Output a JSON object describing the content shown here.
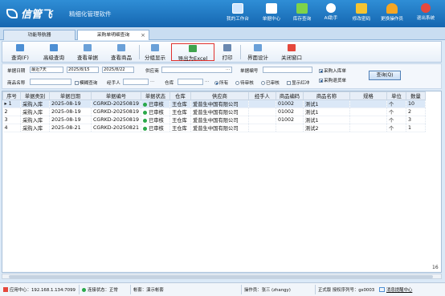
{
  "app": {
    "logo_text": "信管飞",
    "slogan": "精细化管理软件"
  },
  "top_buttons": [
    {
      "label": "我的工作台",
      "icon": "monitor-icon",
      "color": "#cfe6ff"
    },
    {
      "label": "单据中心",
      "icon": "list-icon",
      "color": "#ffffff"
    },
    {
      "label": "库存查询",
      "icon": "table-icon",
      "color": "#7fd34a"
    },
    {
      "label": "AI助手",
      "icon": "info-icon",
      "color": "#ffffff"
    },
    {
      "label": "修改密码",
      "icon": "lock-icon",
      "color": "#f5c431"
    },
    {
      "label": "更换操作员",
      "icon": "user-icon",
      "color": "#f5a623"
    },
    {
      "label": "退出系统",
      "icon": "exit-icon",
      "color": "#e5483c"
    }
  ],
  "tabs": [
    {
      "label": "功能导航器"
    },
    {
      "label": "采购单明细查询"
    }
  ],
  "tab_close": "×",
  "toolbar": [
    {
      "label": "查询(F)",
      "icon": "search-icon",
      "color": "#4d8fd4"
    },
    {
      "label": "高级查询",
      "icon": "advanced-search-icon",
      "color": "#4d8fd4"
    },
    {
      "label": "查看单据",
      "icon": "document-icon",
      "color": "#6aa0d8"
    },
    {
      "label": "查看商品",
      "icon": "product-icon",
      "color": "#6aa0d8"
    },
    {
      "label": "分组显示",
      "icon": "group-icon",
      "color": "#6aa0d8"
    },
    {
      "label": "导出为Excel",
      "icon": "excel-icon",
      "color": "#3fa34d"
    },
    {
      "label": "打印",
      "icon": "print-icon",
      "color": "#6a88b0"
    },
    {
      "label": "界面设计",
      "icon": "design-icon",
      "color": "#6aa0d8"
    },
    {
      "label": "关闭窗口",
      "icon": "close-window-icon",
      "color": "#e5483c"
    }
  ],
  "filters": {
    "date_label": "单据日期",
    "date_range": "最近7天",
    "date_from": "2025/8/15",
    "date_to": "2025/8/22",
    "supplier_label": "供应商",
    "supplier_value": "",
    "doc_no_label": "单据编号",
    "doc_no_value": "",
    "product_label": "商品名称",
    "fuzzy_label": "模糊查询",
    "handler_label": "经手人",
    "warehouse_label": "仓库",
    "radio_all": "所有",
    "radio_unaudited": "待审核",
    "radio_audited": "已审核",
    "show_red": "显示红冲",
    "chk_purchase_in": "采购入库单",
    "chk_purchase_return": "采购退货单",
    "query_button": "查询(Q)",
    "ellipsis": "..."
  },
  "table": {
    "columns": [
      "序号",
      "单据类别",
      "单据日期",
      "单据编号",
      "单据状态",
      "仓库",
      "供应商",
      "经手人",
      "商品编码",
      "商品名称",
      "规格",
      "单位",
      "数量"
    ],
    "rows": [
      {
        "idx": "1",
        "type": "采购入库",
        "date": "2025-08-19",
        "no": "CGRKD-20250819",
        "status": "已审核",
        "wh": "王仓库",
        "supplier": "爱普生中国有限公司",
        "handler": "",
        "code": "01002",
        "name": "测试1",
        "spec": "",
        "unit": "个",
        "qty": "10"
      },
      {
        "idx": "2",
        "type": "采购入库",
        "date": "2025-08-19",
        "no": "CGRKD-20250819",
        "status": "已审核",
        "wh": "王仓库",
        "supplier": "爱普生中国有限公司",
        "handler": "",
        "code": "01002",
        "name": "测试1",
        "spec": "",
        "unit": "个",
        "qty": "2"
      },
      {
        "idx": "3",
        "type": "采购入库",
        "date": "2025-08-19",
        "no": "CGRKD-20250819",
        "status": "已审核",
        "wh": "王仓库",
        "supplier": "爱普生中国有限公司",
        "handler": "",
        "code": "01002",
        "name": "测试1",
        "spec": "",
        "unit": "个",
        "qty": "3"
      },
      {
        "idx": "4",
        "type": "采购入库",
        "date": "2025-08-21",
        "no": "CGRKD-20250821",
        "status": "已审核",
        "wh": "王仓库",
        "supplier": "爱普生中国有限公司",
        "handler": "",
        "code": "",
        "name": "测试2",
        "spec": "",
        "unit": "个",
        "qty": "1"
      }
    ],
    "footer_total": "16"
  },
  "status": {
    "app_center": "应用中心：192.168.1.134:7099",
    "connection": "连接状态：正常",
    "account": "帐套：演示帐套",
    "operator": "操作员：张三 (zhangy)",
    "license": "正式版 授权序列号：gs0003",
    "msg_center": "消息提醒中心"
  },
  "colors": {
    "header": "#1f77c4",
    "accent_red": "#e0312e",
    "status_green": "#2aa84a"
  }
}
